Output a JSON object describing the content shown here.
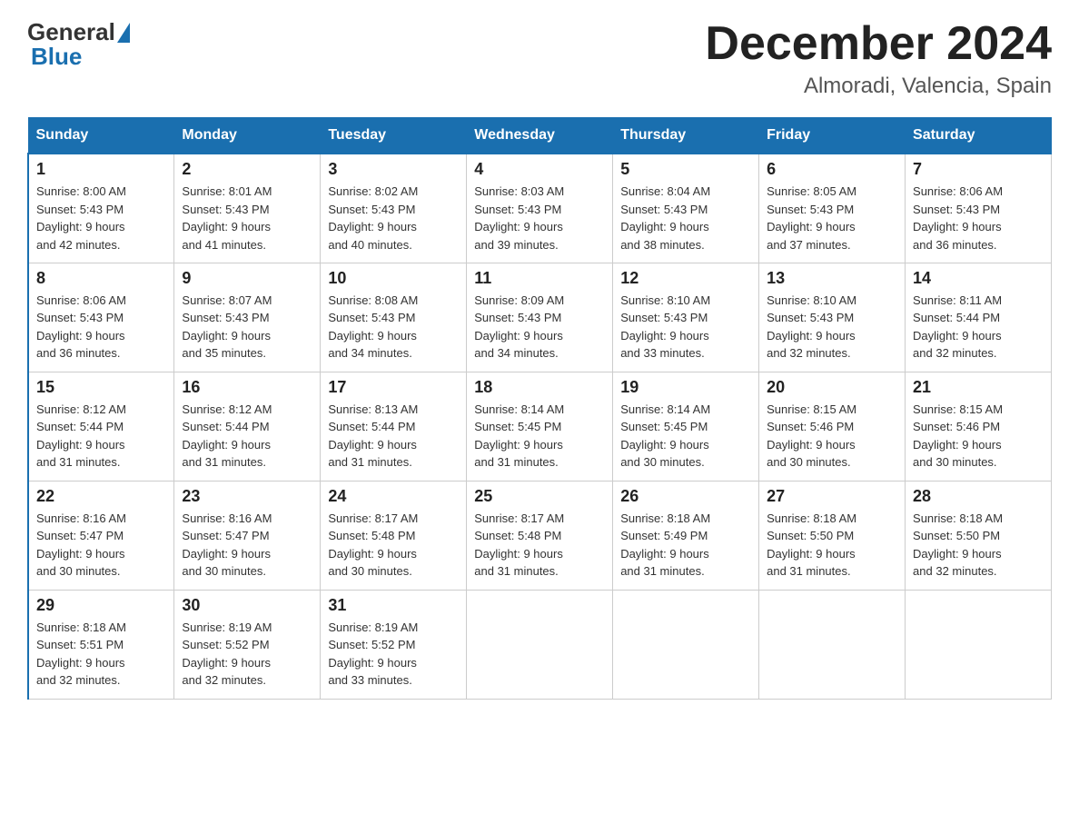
{
  "header": {
    "logo": {
      "general": "General",
      "blue": "Blue"
    },
    "month": "December 2024",
    "location": "Almoradi, Valencia, Spain"
  },
  "weekdays": [
    "Sunday",
    "Monday",
    "Tuesday",
    "Wednesday",
    "Thursday",
    "Friday",
    "Saturday"
  ],
  "weeks": [
    [
      {
        "day": 1,
        "sunrise": "8:00 AM",
        "sunset": "5:43 PM",
        "daylight": "9 hours and 42 minutes."
      },
      {
        "day": 2,
        "sunrise": "8:01 AM",
        "sunset": "5:43 PM",
        "daylight": "9 hours and 41 minutes."
      },
      {
        "day": 3,
        "sunrise": "8:02 AM",
        "sunset": "5:43 PM",
        "daylight": "9 hours and 40 minutes."
      },
      {
        "day": 4,
        "sunrise": "8:03 AM",
        "sunset": "5:43 PM",
        "daylight": "9 hours and 39 minutes."
      },
      {
        "day": 5,
        "sunrise": "8:04 AM",
        "sunset": "5:43 PM",
        "daylight": "9 hours and 38 minutes."
      },
      {
        "day": 6,
        "sunrise": "8:05 AM",
        "sunset": "5:43 PM",
        "daylight": "9 hours and 37 minutes."
      },
      {
        "day": 7,
        "sunrise": "8:06 AM",
        "sunset": "5:43 PM",
        "daylight": "9 hours and 36 minutes."
      }
    ],
    [
      {
        "day": 8,
        "sunrise": "8:06 AM",
        "sunset": "5:43 PM",
        "daylight": "9 hours and 36 minutes."
      },
      {
        "day": 9,
        "sunrise": "8:07 AM",
        "sunset": "5:43 PM",
        "daylight": "9 hours and 35 minutes."
      },
      {
        "day": 10,
        "sunrise": "8:08 AM",
        "sunset": "5:43 PM",
        "daylight": "9 hours and 34 minutes."
      },
      {
        "day": 11,
        "sunrise": "8:09 AM",
        "sunset": "5:43 PM",
        "daylight": "9 hours and 34 minutes."
      },
      {
        "day": 12,
        "sunrise": "8:10 AM",
        "sunset": "5:43 PM",
        "daylight": "9 hours and 33 minutes."
      },
      {
        "day": 13,
        "sunrise": "8:10 AM",
        "sunset": "5:43 PM",
        "daylight": "9 hours and 32 minutes."
      },
      {
        "day": 14,
        "sunrise": "8:11 AM",
        "sunset": "5:44 PM",
        "daylight": "9 hours and 32 minutes."
      }
    ],
    [
      {
        "day": 15,
        "sunrise": "8:12 AM",
        "sunset": "5:44 PM",
        "daylight": "9 hours and 31 minutes."
      },
      {
        "day": 16,
        "sunrise": "8:12 AM",
        "sunset": "5:44 PM",
        "daylight": "9 hours and 31 minutes."
      },
      {
        "day": 17,
        "sunrise": "8:13 AM",
        "sunset": "5:44 PM",
        "daylight": "9 hours and 31 minutes."
      },
      {
        "day": 18,
        "sunrise": "8:14 AM",
        "sunset": "5:45 PM",
        "daylight": "9 hours and 31 minutes."
      },
      {
        "day": 19,
        "sunrise": "8:14 AM",
        "sunset": "5:45 PM",
        "daylight": "9 hours and 30 minutes."
      },
      {
        "day": 20,
        "sunrise": "8:15 AM",
        "sunset": "5:46 PM",
        "daylight": "9 hours and 30 minutes."
      },
      {
        "day": 21,
        "sunrise": "8:15 AM",
        "sunset": "5:46 PM",
        "daylight": "9 hours and 30 minutes."
      }
    ],
    [
      {
        "day": 22,
        "sunrise": "8:16 AM",
        "sunset": "5:47 PM",
        "daylight": "9 hours and 30 minutes."
      },
      {
        "day": 23,
        "sunrise": "8:16 AM",
        "sunset": "5:47 PM",
        "daylight": "9 hours and 30 minutes."
      },
      {
        "day": 24,
        "sunrise": "8:17 AM",
        "sunset": "5:48 PM",
        "daylight": "9 hours and 30 minutes."
      },
      {
        "day": 25,
        "sunrise": "8:17 AM",
        "sunset": "5:48 PM",
        "daylight": "9 hours and 31 minutes."
      },
      {
        "day": 26,
        "sunrise": "8:18 AM",
        "sunset": "5:49 PM",
        "daylight": "9 hours and 31 minutes."
      },
      {
        "day": 27,
        "sunrise": "8:18 AM",
        "sunset": "5:50 PM",
        "daylight": "9 hours and 31 minutes."
      },
      {
        "day": 28,
        "sunrise": "8:18 AM",
        "sunset": "5:50 PM",
        "daylight": "9 hours and 32 minutes."
      }
    ],
    [
      {
        "day": 29,
        "sunrise": "8:18 AM",
        "sunset": "5:51 PM",
        "daylight": "9 hours and 32 minutes."
      },
      {
        "day": 30,
        "sunrise": "8:19 AM",
        "sunset": "5:52 PM",
        "daylight": "9 hours and 32 minutes."
      },
      {
        "day": 31,
        "sunrise": "8:19 AM",
        "sunset": "5:52 PM",
        "daylight": "9 hours and 33 minutes."
      },
      null,
      null,
      null,
      null
    ]
  ],
  "labels": {
    "sunrise": "Sunrise:",
    "sunset": "Sunset:",
    "daylight": "Daylight:"
  }
}
